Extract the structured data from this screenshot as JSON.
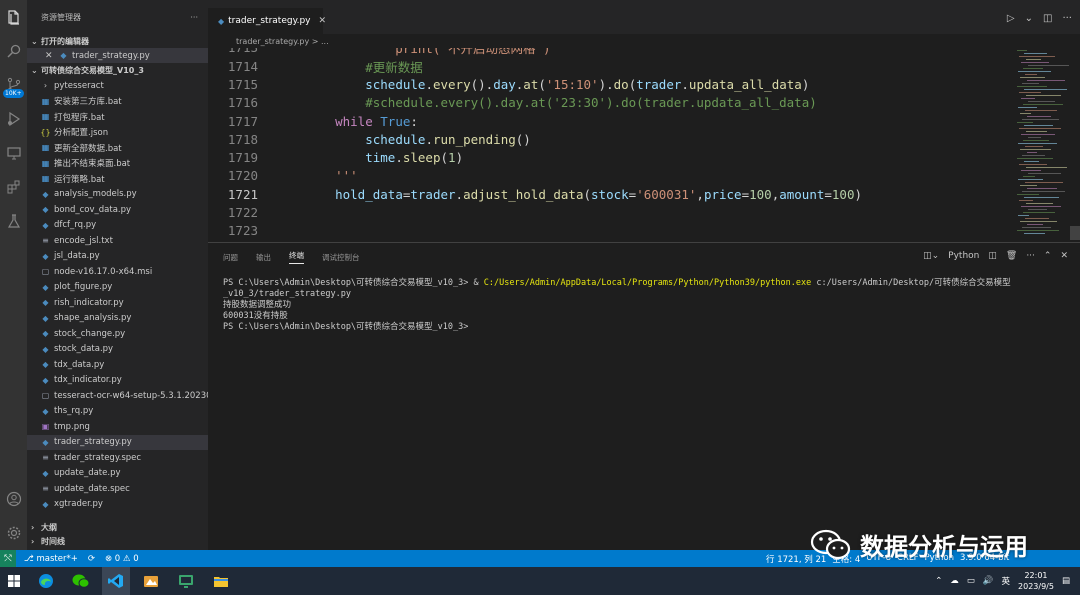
{
  "activity_bar": {
    "icons": [
      "explorer-icon",
      "search-icon",
      "source-control-icon",
      "run-debug-icon",
      "remote-explorer-icon",
      "extensions-icon",
      "testing-icon"
    ],
    "badge": "10K+",
    "bottom_icons": [
      "account-icon",
      "manage-gear-icon"
    ]
  },
  "sidebar": {
    "title": "资源管理器",
    "more": "···",
    "open_editors_label": "打开的编辑器",
    "open_editors": [
      {
        "name": "trader_strategy.py"
      }
    ],
    "project_label": "可转债综合交易模型_V10_3",
    "items": [
      {
        "name": "pytesseract",
        "type": "folder"
      },
      {
        "name": "安装第三方库.bat",
        "type": "bat"
      },
      {
        "name": "打包程序.bat",
        "type": "bat"
      },
      {
        "name": "分析配置.json",
        "type": "json"
      },
      {
        "name": "更新全部数据.bat",
        "type": "bat"
      },
      {
        "name": "推出不结束桌面.bat",
        "type": "bat"
      },
      {
        "name": "运行策略.bat",
        "type": "bat"
      },
      {
        "name": "analysis_models.py",
        "type": "py"
      },
      {
        "name": "bond_cov_data.py",
        "type": "py"
      },
      {
        "name": "dfcf_rq.py",
        "type": "py"
      },
      {
        "name": "encode_jsl.txt",
        "type": "txt"
      },
      {
        "name": "jsl_data.py",
        "type": "py"
      },
      {
        "name": "node-v16.17.0-x64.msi",
        "type": "msi"
      },
      {
        "name": "plot_figure.py",
        "type": "py"
      },
      {
        "name": "rish_indicator.py",
        "type": "py"
      },
      {
        "name": "shape_analysis.py",
        "type": "py"
      },
      {
        "name": "stock_change.py",
        "type": "py"
      },
      {
        "name": "stock_data.py",
        "type": "py"
      },
      {
        "name": "tdx_data.py",
        "type": "py"
      },
      {
        "name": "tdx_indicator.py",
        "type": "py"
      },
      {
        "name": "tesseract-ocr-w64-setup-5.3.1.20230...",
        "type": "exe"
      },
      {
        "name": "ths_rq.py",
        "type": "py"
      },
      {
        "name": "tmp.png",
        "type": "png"
      },
      {
        "name": "trader_strategy.py",
        "type": "py",
        "selected": true
      },
      {
        "name": "trader_strategy.spec",
        "type": "spec"
      },
      {
        "name": "update_date.py",
        "type": "py"
      },
      {
        "name": "update_date.spec",
        "type": "spec"
      },
      {
        "name": "xgtrader.py",
        "type": "py"
      }
    ],
    "outline_label": "大纲",
    "timeline_label": "时间线"
  },
  "editor": {
    "tab_label": "trader_strategy.py",
    "breadcrumb": "trader_strategy.py > ...",
    "first_line_number": "1713",
    "lines": [
      {
        "n": "1714",
        "tokens": [
          {
            "t": "        ",
            "c": "pl"
          },
          {
            "t": "#更新数据",
            "c": "cm"
          }
        ]
      },
      {
        "n": "1715",
        "tokens": [
          {
            "t": "        ",
            "c": "pl"
          },
          {
            "t": "schedule",
            "c": "var"
          },
          {
            "t": ".",
            "c": "pl"
          },
          {
            "t": "every",
            "c": "fn"
          },
          {
            "t": "().",
            "c": "pl"
          },
          {
            "t": "day",
            "c": "var"
          },
          {
            "t": ".",
            "c": "pl"
          },
          {
            "t": "at",
            "c": "fn"
          },
          {
            "t": "(",
            "c": "pl"
          },
          {
            "t": "'15:10'",
            "c": "str"
          },
          {
            "t": ").",
            "c": "pl"
          },
          {
            "t": "do",
            "c": "fn"
          },
          {
            "t": "(",
            "c": "pl"
          },
          {
            "t": "trader",
            "c": "var"
          },
          {
            "t": ".",
            "c": "pl"
          },
          {
            "t": "updata_all_data",
            "c": "fn"
          },
          {
            "t": ")",
            "c": "pl"
          }
        ]
      },
      {
        "n": "1716",
        "tokens": [
          {
            "t": "        ",
            "c": "pl"
          },
          {
            "t": "#schedule.every().day.at('23:30').do(trader.updata_all_data)",
            "c": "cm"
          }
        ]
      },
      {
        "n": "1717",
        "tokens": [
          {
            "t": "    ",
            "c": "pl"
          },
          {
            "t": "while",
            "c": "kw"
          },
          {
            "t": " ",
            "c": "pl"
          },
          {
            "t": "True",
            "c": "kw2"
          },
          {
            "t": ":",
            "c": "pl"
          }
        ]
      },
      {
        "n": "1718",
        "tokens": [
          {
            "t": "        ",
            "c": "pl"
          },
          {
            "t": "schedule",
            "c": "var"
          },
          {
            "t": ".",
            "c": "pl"
          },
          {
            "t": "run_pending",
            "c": "fn"
          },
          {
            "t": "()",
            "c": "pl"
          }
        ]
      },
      {
        "n": "1719",
        "tokens": [
          {
            "t": "        ",
            "c": "pl"
          },
          {
            "t": "time",
            "c": "var"
          },
          {
            "t": ".",
            "c": "pl"
          },
          {
            "t": "sleep",
            "c": "fn"
          },
          {
            "t": "(",
            "c": "pl"
          },
          {
            "t": "1",
            "c": "num"
          },
          {
            "t": ")",
            "c": "pl"
          }
        ]
      },
      {
        "n": "1720",
        "tokens": [
          {
            "t": "    ",
            "c": "pl"
          },
          {
            "t": "'''",
            "c": "str"
          }
        ]
      },
      {
        "n": "1721",
        "current": true,
        "tokens": [
          {
            "t": "    ",
            "c": "pl"
          },
          {
            "t": "hold_data",
            "c": "var"
          },
          {
            "t": "=",
            "c": "pl"
          },
          {
            "t": "trader",
            "c": "var"
          },
          {
            "t": ".",
            "c": "pl"
          },
          {
            "t": "adjust_hold_data",
            "c": "fn"
          },
          {
            "t": "(",
            "c": "pl"
          },
          {
            "t": "stock",
            "c": "var"
          },
          {
            "t": "=",
            "c": "pl"
          },
          {
            "t": "'600031'",
            "c": "str"
          },
          {
            "t": ",",
            "c": "pl"
          },
          {
            "t": "price",
            "c": "var"
          },
          {
            "t": "=",
            "c": "pl"
          },
          {
            "t": "100",
            "c": "num"
          },
          {
            "t": ",",
            "c": "pl"
          },
          {
            "t": "amount",
            "c": "var"
          },
          {
            "t": "=",
            "c": "pl"
          },
          {
            "t": "100",
            "c": "num"
          },
          {
            "t": ")",
            "c": "pl"
          }
        ]
      },
      {
        "n": "1722",
        "tokens": []
      },
      {
        "n": "1723",
        "tokens": []
      }
    ],
    "partial_top_line": "            print('不开启动态网格')"
  },
  "panel": {
    "tabs": [
      "问题",
      "输出",
      "终端",
      "调试控制台"
    ],
    "active_tab": "终端",
    "shell_label": "Python",
    "terminal": {
      "prompt1": "PS C:\\Users\\Admin\\Desktop\\可转债综合交易模型_v10_3> & ",
      "exe_path": "C:/Users/Admin/AppData/Local/Programs/Python/Python39/python.exe",
      "script_arg": " c:/Users/Admin/Desktop/可转债综合交易模型_v10_3/trader_strategy.py",
      "output1": "持股数据调整成功",
      "output2": "600031没有持股",
      "prompt2": "PS C:\\Users\\Admin\\Desktop\\可转债综合交易模型_v10_3>"
    }
  },
  "statusbar": {
    "branch": "master*+",
    "problems": "⊗ 0 ⚠ 0",
    "position": "行 1721, 列 21",
    "spaces": "空格: 4",
    "encoding": "UTF-8",
    "eol": "CRLF",
    "language": "Python",
    "python_version": "3.9.0 64-bit"
  },
  "watermark": {
    "text": "数据分析与运用"
  },
  "taskbar": {
    "apps": [
      "edge-icon",
      "wechat-icon",
      "vscode-icon",
      "app-icon",
      "remote-icon",
      "file-explorer-icon"
    ],
    "ime": "英",
    "time": "22:01",
    "date": "2023/9/5"
  },
  "colors": {
    "accent": "#007acc",
    "editor_bg": "#1e1e1e",
    "sidebar_bg": "#252526",
    "activity_bg": "#333333",
    "keyword": "#c586c0",
    "string": "#ce9178",
    "comment": "#6a9955",
    "function": "#dcdcaa",
    "variable": "#9cdcfe",
    "number": "#b5cea8"
  }
}
